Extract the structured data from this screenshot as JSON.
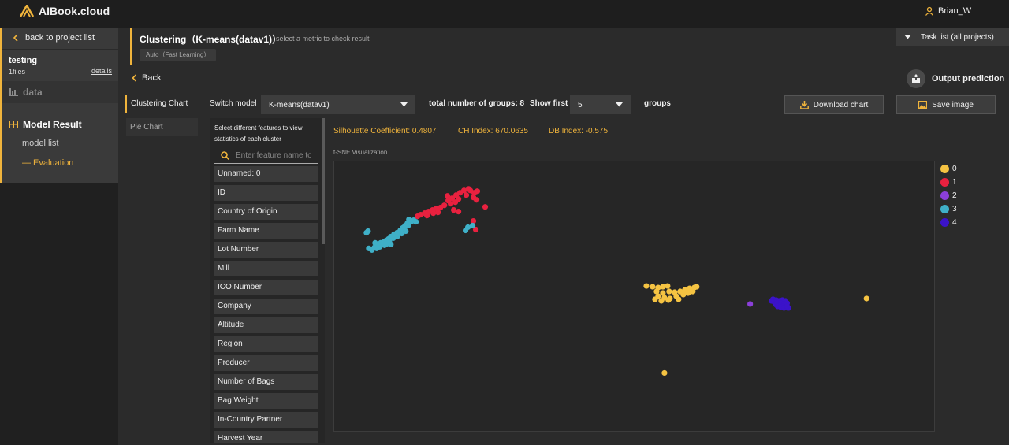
{
  "app": {
    "title": "AIBook.cloud",
    "user": "Brian_W"
  },
  "sidebar": {
    "back_label": "back to project list",
    "project_name": "testing",
    "files": "1files",
    "details": "details",
    "data_label": "data",
    "model_result": "Model Result",
    "model_list": "model list",
    "evaluation": "— Evaluation"
  },
  "header": {
    "title": "Clustering（K-means(datav1)）",
    "hint": "select a metric to check result",
    "badge": "Auto（Fast Learning）",
    "task_list": "Task list (all projects)",
    "back": "Back",
    "output_prediction": "Output prediction"
  },
  "tabs": {
    "clustering": "Clustering Chart",
    "pie": "Pie Chart"
  },
  "controls": {
    "switch_model_label": "Switch model",
    "model_value": "K-means(datav1)",
    "total_groups": "total number of groups: 8",
    "show_first_label": "Show first",
    "show_first_value": "5",
    "groups_label": "groups",
    "download": "Download chart",
    "save": "Save image"
  },
  "features": {
    "heading": "Select different features to view statistics of each cluster",
    "search_placeholder": "Enter feature name to",
    "items": [
      "Unnamed: 0",
      "ID",
      "Country of Origin",
      "Farm Name",
      "Lot Number",
      "Mill",
      "ICO Number",
      "Company",
      "Altitude",
      "Region",
      "Producer",
      "Number of Bags",
      "Bag Weight",
      "In-Country Partner",
      "Harvest Year"
    ]
  },
  "metrics": {
    "silhouette": "Silhouette Coefficient: 0.4807",
    "ch": "CH Index: 670.0635",
    "db": "DB Index: -0.575"
  },
  "chart_label": "t-SNE Visualization",
  "colors": {
    "accent": "#f0b43c",
    "c0": "#f5c342",
    "c1": "#e8213f",
    "c2": "#8b3fd9",
    "c3": "#3fb0c8",
    "c4": "#3b13c9"
  },
  "chart_data": {
    "type": "scatter",
    "title": "t-SNE Visualization",
    "legend": [
      "0",
      "1",
      "2",
      "3",
      "4"
    ],
    "legend_position": "right",
    "xlim": [
      0,
      763
    ],
    "ylim": [
      0,
      344
    ],
    "series": [
      {
        "name": "0",
        "points": [
          [
            397,
            159
          ],
          [
            405,
            160
          ],
          [
            412,
            161
          ],
          [
            418,
            160
          ],
          [
            424,
            159
          ],
          [
            410,
            166
          ],
          [
            418,
            168
          ],
          [
            426,
            166
          ],
          [
            433,
            167
          ],
          [
            440,
            166
          ],
          [
            446,
            164
          ],
          [
            452,
            162
          ],
          [
            458,
            161
          ],
          [
            461,
            160
          ],
          [
            412,
            172
          ],
          [
            420,
            174
          ],
          [
            427,
            175
          ],
          [
            435,
            172
          ],
          [
            444,
            170
          ],
          [
            450,
            168
          ],
          [
            456,
            166
          ],
          [
            408,
            176
          ],
          [
            416,
            178
          ],
          [
            425,
            177
          ],
          [
            438,
            176
          ],
          [
            677,
            175
          ],
          [
            420,
            270
          ]
        ]
      },
      {
        "name": "1",
        "points": [
          [
            173,
            37
          ],
          [
            178,
            40
          ],
          [
            168,
            43
          ],
          [
            165,
            37
          ],
          [
            171,
            35
          ],
          [
            160,
            40
          ],
          [
            155,
            43
          ],
          [
            150,
            47
          ],
          [
            145,
            50
          ],
          [
            158,
            48
          ],
          [
            154,
            52
          ],
          [
            148,
            54
          ],
          [
            152,
            62
          ],
          [
            158,
            64
          ],
          [
            140,
            56
          ],
          [
            135,
            59
          ],
          [
            130,
            60
          ],
          [
            125,
            62
          ],
          [
            120,
            64
          ],
          [
            115,
            66
          ],
          [
            110,
            68
          ],
          [
            106,
            70
          ],
          [
            132,
            65
          ],
          [
            126,
            66
          ],
          [
            118,
            69
          ],
          [
            181,
            49
          ],
          [
            192,
            58
          ],
          [
            177,
            76
          ],
          [
            180,
            87
          ],
          [
            182,
            38
          ],
          [
            177,
            46
          ],
          [
            144,
            44
          ]
        ]
      },
      {
        "name": "2",
        "points": [
          [
            529,
            182
          ],
          [
            565,
            182
          ]
        ]
      },
      {
        "name": "3",
        "points": [
          [
            95,
            74
          ],
          [
            98,
            77
          ],
          [
            93,
            79
          ],
          [
            90,
            82
          ],
          [
            87,
            85
          ],
          [
            94,
            82
          ],
          [
            84,
            88
          ],
          [
            80,
            91
          ],
          [
            76,
            93
          ],
          [
            72,
            96
          ],
          [
            69,
            99
          ],
          [
            66,
            101
          ],
          [
            63,
            103
          ],
          [
            60,
            106
          ],
          [
            56,
            107
          ],
          [
            51,
            110
          ],
          [
            48,
            113
          ],
          [
            54,
            111
          ],
          [
            58,
            109
          ],
          [
            64,
            107
          ],
          [
            70,
            102
          ],
          [
            75,
            98
          ],
          [
            80,
            96
          ],
          [
            86,
            92
          ],
          [
            91,
            89
          ],
          [
            59,
            104
          ],
          [
            66,
            106
          ],
          [
            52,
            104
          ],
          [
            44,
            111
          ],
          [
            72,
            106
          ],
          [
            41,
            91
          ],
          [
            43,
            89
          ],
          [
            170,
            84
          ],
          [
            167,
            88
          ],
          [
            176,
            82
          ],
          [
            101,
            75
          ],
          [
            104,
            77
          ]
        ]
      },
      {
        "name": "4",
        "points": [
          [
            558,
            176
          ],
          [
            562,
            177
          ],
          [
            566,
            178
          ],
          [
            570,
            177
          ],
          [
            574,
            178
          ],
          [
            560,
            180
          ],
          [
            564,
            181
          ],
          [
            568,
            181
          ],
          [
            572,
            182
          ],
          [
            576,
            181
          ],
          [
            562,
            183
          ],
          [
            566,
            184
          ],
          [
            570,
            185
          ],
          [
            574,
            186
          ],
          [
            578,
            187
          ],
          [
            564,
            185
          ],
          [
            568,
            186
          ],
          [
            572,
            187
          ],
          [
            576,
            185
          ],
          [
            556,
            178
          ]
        ]
      }
    ]
  }
}
